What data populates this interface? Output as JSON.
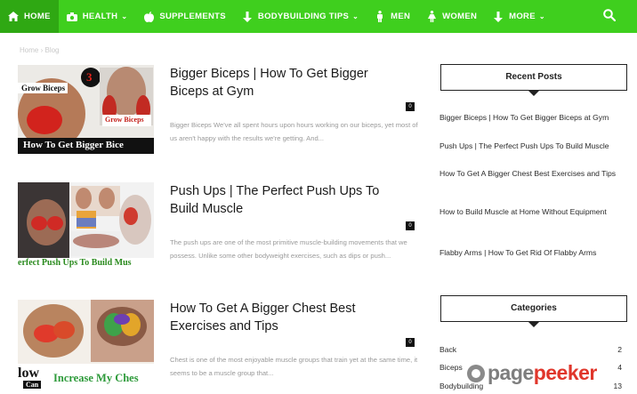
{
  "nav": {
    "items": [
      {
        "label": "HOME",
        "icon": "home-icon"
      },
      {
        "label": "HEALTH",
        "icon": "camera-icon"
      },
      {
        "label": "SUPPLEMENTS",
        "icon": "apple-icon"
      },
      {
        "label": "BODYBUILDING TIPS",
        "icon": "arrow-down-icon"
      },
      {
        "label": "MEN",
        "icon": "male-icon"
      },
      {
        "label": "WOMEN",
        "icon": "female-icon"
      },
      {
        "label": "MORE",
        "icon": "arrow-down-icon"
      }
    ],
    "search_icon": "search-icon",
    "colors": {
      "bar": "#3fcf1e",
      "active": "#2fa813"
    }
  },
  "breadcrumb": {
    "home": "Home",
    "separator": "›",
    "current": "Blog"
  },
  "posts": [
    {
      "title": "Bigger Biceps | How To Get Bigger Biceps at Gym",
      "comments": "0",
      "excerpt": "Bigger Biceps We've all spent hours upon hours working on our biceps, yet most of us aren't happy with the results we're getting. And...",
      "thumb": {
        "badge": "3",
        "top_text": "Grow Biceps",
        "side_text": "Grow Biceps",
        "bottom_text": "How To Get Bigger Bice"
      }
    },
    {
      "title": "Push Ups | The Perfect Push Ups To Build Muscle",
      "comments": "0",
      "excerpt": "The push ups are one of the most primitive muscle-building movements that we possess. Unlike some other bodyweight exercises, such as dips or push...",
      "thumb": {
        "bottom_text": "erfect Push Ups To Build Mus"
      }
    },
    {
      "title": "How To Get A Bigger Chest Best Exercises and Tips",
      "comments": "0",
      "excerpt": "Chest is one of the most enjoyable muscle groups that train yet at the same time, it seems to be a muscle group that...",
      "thumb": {
        "bottom_left": "low",
        "bottom_left2": "Can",
        "bottom_text": "Increase My Ches"
      }
    }
  ],
  "sidebar": {
    "recent_title": "Recent Posts",
    "recent": [
      "Bigger Biceps | How To Get Bigger Biceps at Gym",
      "Push Ups | The Perfect Push Ups To Build Muscle",
      "How To Get A Bigger Chest Best Exercises and Tips",
      "How to Build Muscle at Home Without Equipment",
      "Flabby Arms | How To Get Rid Of Flabby Arms"
    ],
    "categories_title": "Categories",
    "categories": [
      {
        "name": "Back",
        "count": "2"
      },
      {
        "name": "Biceps",
        "count": "4"
      },
      {
        "name": "Bodybuilding",
        "count": "13"
      }
    ]
  },
  "watermark": {
    "page": "page",
    "peeker": "peeker"
  }
}
